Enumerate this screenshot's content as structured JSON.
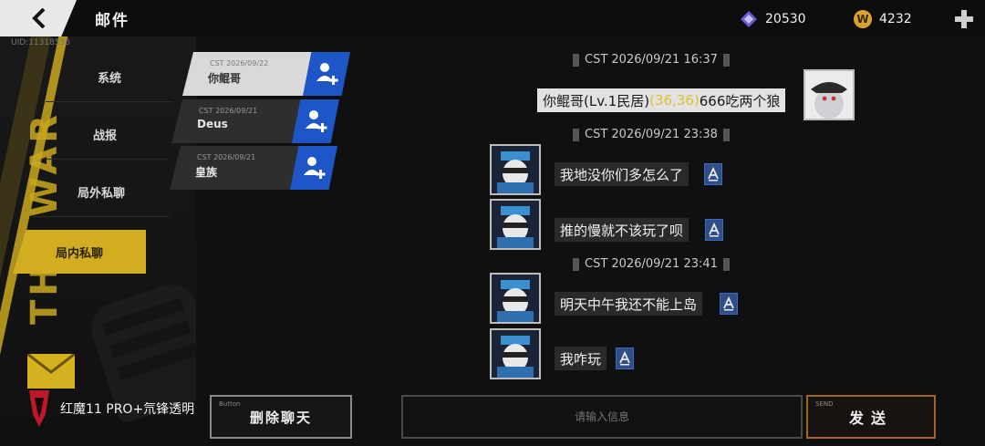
{
  "header": {
    "title": "邮件",
    "uid": "UID:11318556",
    "gems": "20530",
    "coins": "4232",
    "coin_letter": "W"
  },
  "decor": {
    "side_text": "THE WAR"
  },
  "categories": [
    {
      "label": "系统"
    },
    {
      "label": "战报"
    },
    {
      "label": "局外私聊"
    },
    {
      "label": "局内私聊",
      "active": true
    }
  ],
  "chats": [
    {
      "date": "CST 2026/09/22",
      "name": "你鲲哥",
      "active": true
    },
    {
      "date": "CST 2026/09/21",
      "name": "Deus"
    },
    {
      "date": "CST 2026/09/21",
      "name": "皇族"
    }
  ],
  "messages": {
    "timestamps": [
      "CST 2026/09/21 16:37",
      "CST 2026/09/21 23:38",
      "CST 2026/09/21 23:41"
    ],
    "self": {
      "prefix": "你鲲哥(Lv.1民居)",
      "coords": "(36,36)",
      "suffix": "666吃两个狼"
    },
    "others": [
      "我地没你们多怎么了",
      "推的慢就不该玩了呗",
      "明天中午我还不能上岛",
      "我咋玩"
    ]
  },
  "footer": {
    "button_tag": "Button",
    "delete_label": "删除聊天",
    "input_placeholder": "请输入信息",
    "send_tag": "SEND",
    "send_label": "发送",
    "watermark": "红魔11 PRO+氘锋透明"
  },
  "colors": {
    "accent_yellow": "#d1ad1f",
    "blue": "#1f56c7",
    "send_border": "#a4651c"
  }
}
